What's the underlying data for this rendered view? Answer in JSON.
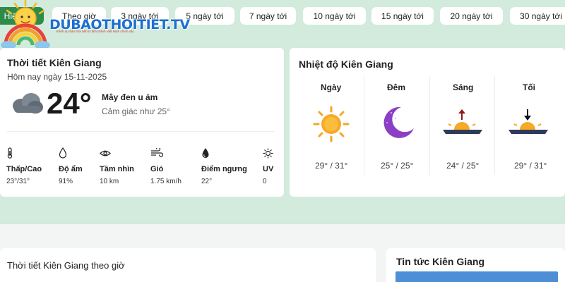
{
  "logo": {
    "text": "DUBAOTHOITIET.TV",
    "subtitle": "Kênh dự báo thời tiết 63 tỉnh thành Việt Nam chính xác"
  },
  "tabs": [
    {
      "label": "Hiện tại",
      "active": true
    },
    {
      "label": "Theo giờ"
    },
    {
      "label": "3 ngày tới"
    },
    {
      "label": "5 ngày tới"
    },
    {
      "label": "7 ngày tới"
    },
    {
      "label": "10 ngày tới"
    },
    {
      "label": "15 ngày tới"
    },
    {
      "label": "20 ngày tới"
    },
    {
      "label": "30 ngày tới"
    }
  ],
  "current": {
    "title": "Thời tiết Kiên Giang",
    "date": "Hôm nay ngày 15-11-2025",
    "temperature": "24°",
    "condition": "Mây đen u ám",
    "feels_like": "Cảm giác như 25°",
    "icon": "cloud-icon",
    "stats": [
      {
        "label": "Thấp/Cao",
        "value": "23°/31°",
        "icon": "thermometer-icon"
      },
      {
        "label": "Độ ẩm",
        "value": "91%",
        "icon": "humidity-drop-icon"
      },
      {
        "label": "Tầm nhìn",
        "value": "10 km",
        "icon": "eye-icon"
      },
      {
        "label": "Gió",
        "value": "1.75 km/h",
        "icon": "wind-icon"
      },
      {
        "label": "Điểm ngưng",
        "value": "22°",
        "icon": "dew-point-icon"
      },
      {
        "label": "UV",
        "value": "0",
        "icon": "uv-sun-icon"
      }
    ]
  },
  "temps": {
    "title": "Nhiệt độ Kiên Giang",
    "periods": [
      {
        "label": "Ngày",
        "range": "29° / 31°",
        "icon": "sun-icon"
      },
      {
        "label": "Đêm",
        "range": "25° / 25°",
        "icon": "moon-icon"
      },
      {
        "label": "Sáng",
        "range": "24° / 25°",
        "icon": "sunrise-icon"
      },
      {
        "label": "Tối",
        "range": "29° / 31°",
        "icon": "sunset-icon"
      }
    ]
  },
  "hourly": {
    "title": "Thời tiết Kiên Giang theo giờ"
  },
  "news": {
    "title": "Tin tức Kiên Giang"
  },
  "colors": {
    "accent": "#2e8b4a",
    "band": "#d2ebdc",
    "sun": "#f5a623",
    "moon": "#8a3fc4"
  }
}
